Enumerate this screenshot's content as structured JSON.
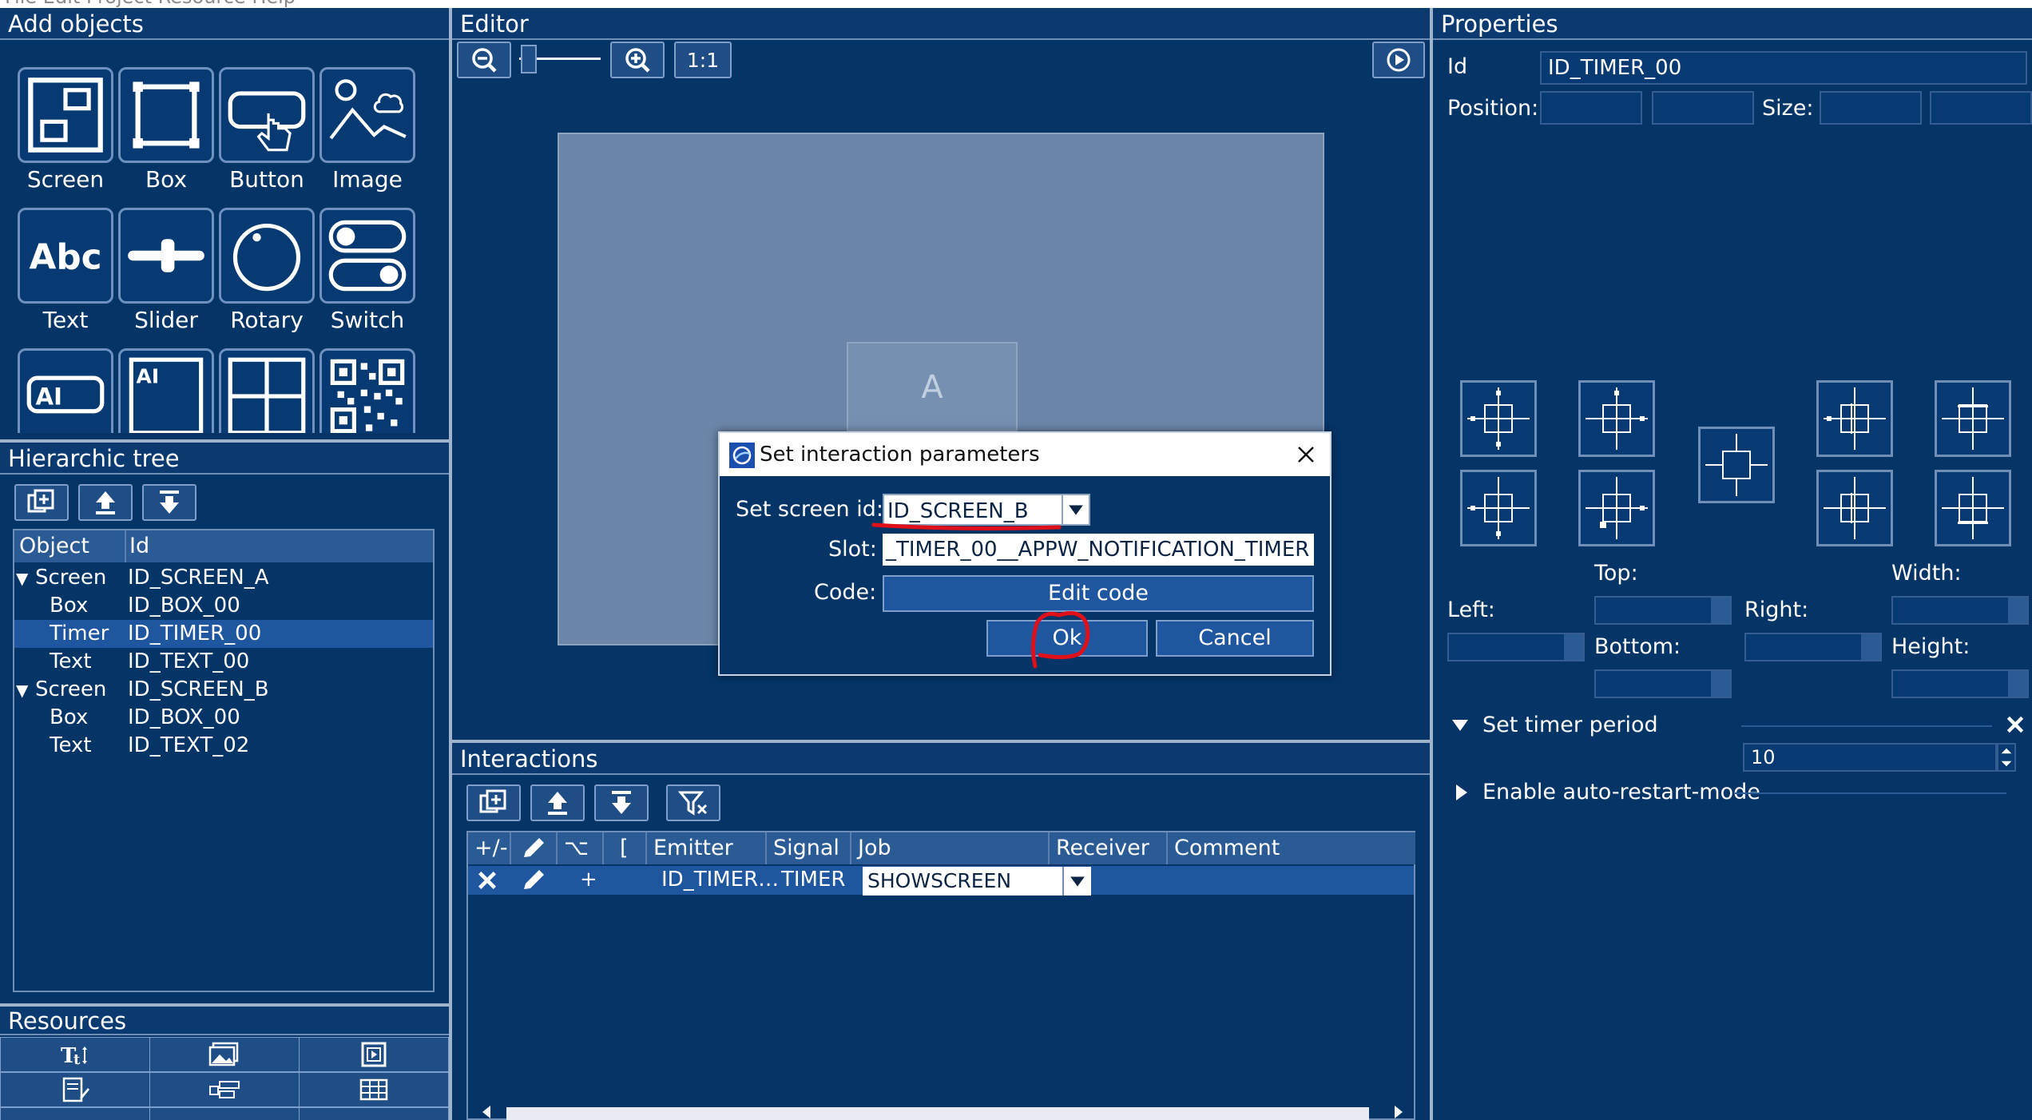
{
  "window": {
    "title_fragment": "File Edit Project Resource Help"
  },
  "add_objects": {
    "title": "Add objects",
    "tiles": [
      {
        "label": "Screen",
        "icon": "screen-icon"
      },
      {
        "label": "Box",
        "icon": "box-icon"
      },
      {
        "label": "Button",
        "icon": "button-icon"
      },
      {
        "label": "Image",
        "icon": "image-icon"
      },
      {
        "label": "Text",
        "icon": "text-abc-icon"
      },
      {
        "label": "Slider",
        "icon": "slider-icon"
      },
      {
        "label": "Rotary",
        "icon": "rotary-icon"
      },
      {
        "label": "Switch",
        "icon": "switch-icon"
      },
      {
        "label": "",
        "icon": "ai-edit-icon"
      },
      {
        "label": "",
        "icon": "ai-multiedit-icon"
      },
      {
        "label": "",
        "icon": "table-grid-icon"
      },
      {
        "label": "",
        "icon": "qr-code-icon"
      }
    ]
  },
  "hierarchic_tree": {
    "title": "Hierarchic tree",
    "columns": [
      "Object",
      "Id"
    ],
    "rows": [
      {
        "object": "Screen",
        "id": "ID_SCREEN_A",
        "expanded": true,
        "level": 0
      },
      {
        "object": "Box",
        "id": "ID_BOX_00",
        "level": 1
      },
      {
        "object": "Timer",
        "id": "ID_TIMER_00",
        "level": 1,
        "selected": true
      },
      {
        "object": "Text",
        "id": "ID_TEXT_00",
        "level": 1
      },
      {
        "object": "Screen",
        "id": "ID_SCREEN_B",
        "expanded": true,
        "level": 0
      },
      {
        "object": "Box",
        "id": "ID_BOX_00",
        "level": 1
      },
      {
        "object": "Text",
        "id": "ID_TEXT_02",
        "level": 1
      }
    ]
  },
  "resources": {
    "title": "Resources"
  },
  "editor": {
    "title": "Editor",
    "zoom_reset_label": "1:1",
    "canvas_box_label": "A"
  },
  "interactions": {
    "title": "Interactions",
    "columns": [
      "+/-",
      "",
      "⌥",
      "[",
      "Emitter",
      "Signal",
      "Job",
      "Receiver",
      "Comment"
    ],
    "rows": [
      {
        "plus": "+",
        "emitter": "ID_TIMER…",
        "signal": "TIMER",
        "job": "SHOWSCREEN",
        "receiver": "",
        "comment": ""
      }
    ]
  },
  "properties": {
    "title": "Properties",
    "id_label": "Id",
    "id_value": "ID_TIMER_00",
    "position_label": "Position:",
    "size_label": "Size:",
    "top_label": "Top:",
    "width_label": "Width:",
    "left_label": "Left:",
    "right_label": "Right:",
    "bottom_label": "Bottom:",
    "height_label": "Height:",
    "timer_section": "Set timer period",
    "timer_value": "10",
    "autorestart_section": "Enable auto-restart-mode"
  },
  "dialog": {
    "title": "Set interaction parameters",
    "screen_label": "Set screen id:",
    "screen_value": "ID_SCREEN_B",
    "slot_label": "Slot:",
    "slot_value": "_TIMER_00__APPW_NOTIFICATION_TIMER",
    "code_label": "Code:",
    "edit_code_label": "Edit code",
    "ok_label": "Ok",
    "cancel_label": "Cancel"
  },
  "colors": {
    "background": "#043064",
    "panel_header": "#0a3a70",
    "selection": "#1f56a0",
    "annotation_red": "#e0101a"
  }
}
